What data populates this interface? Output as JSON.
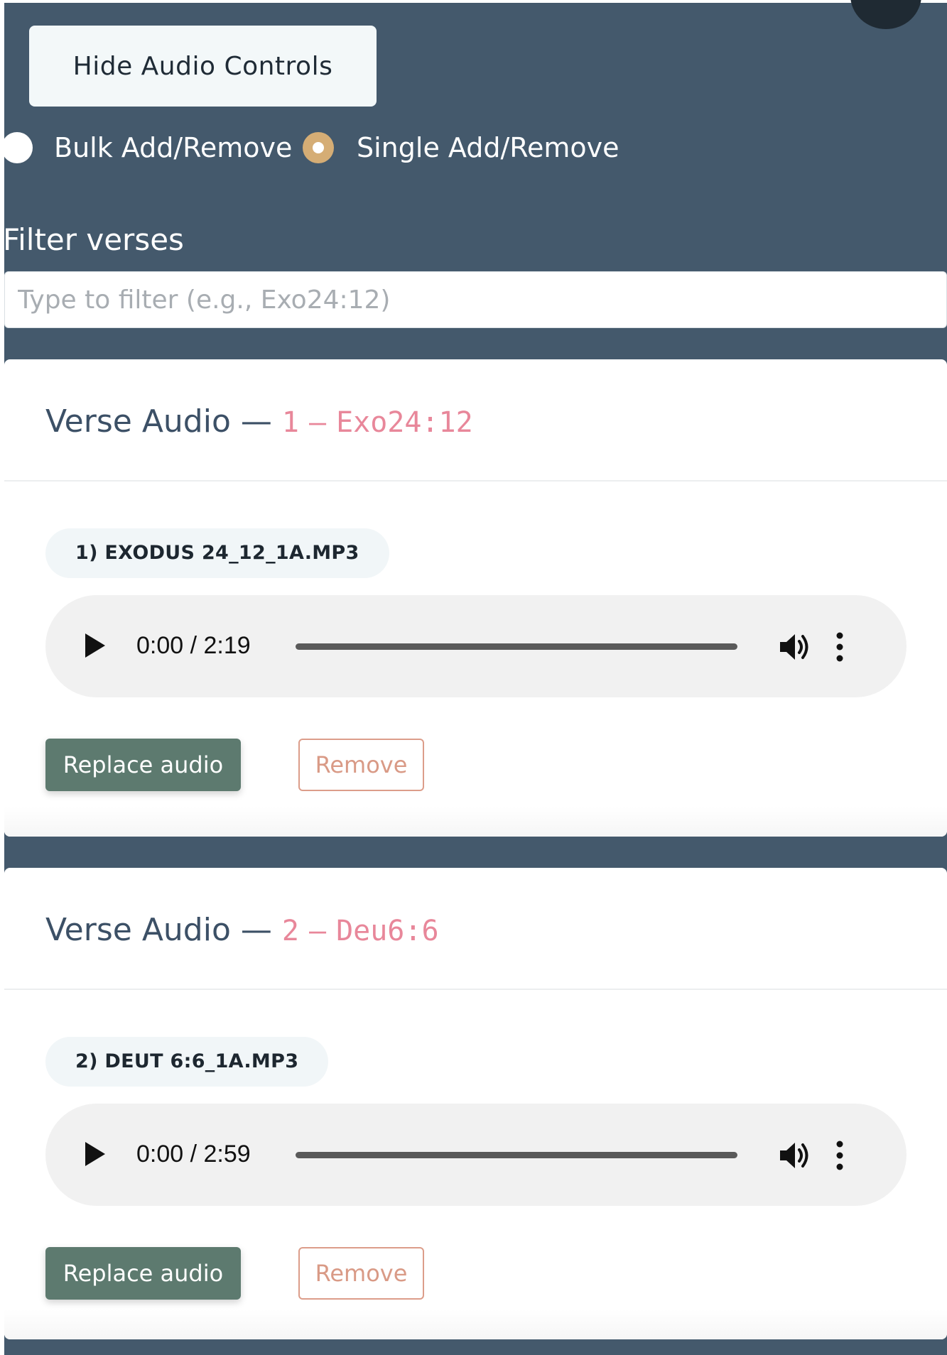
{
  "controls": {
    "toggle_label": "Hide Audio Controls",
    "mode": {
      "options": [
        "Bulk Add/Remove",
        "Single Add/Remove"
      ],
      "selected": "Single Add/Remove"
    }
  },
  "filter": {
    "label": "Filter verses",
    "placeholder": "Type to filter (e.g., Exo24:12)",
    "value": ""
  },
  "cards": [
    {
      "title_prefix": "Verse Audio —",
      "index": "1",
      "separator": "–",
      "verse": "Exo24:12",
      "file_name": "1) EXODUS 24_12_1A.MP3",
      "player": {
        "time": "0:00 / 2:19",
        "progress": 0
      },
      "replace_label": "Replace audio",
      "remove_label": "Remove"
    },
    {
      "title_prefix": "Verse Audio —",
      "index": "2",
      "separator": "–",
      "verse": "Deu6:6",
      "file_name": "2) DEUT 6:6_1A.MP3",
      "player": {
        "time": "0:00 / 2:59",
        "progress": 0
      },
      "replace_label": "Replace audio",
      "remove_label": "Remove"
    }
  ],
  "icons": {
    "play": "play-icon",
    "volume": "volume-icon",
    "more": "more-vertical-icon"
  },
  "colors": {
    "panel_bg": "#44596c",
    "accent_radio": "#d5ad75",
    "verse_ref": "#e8879a",
    "replace_button": "#5d7a6f",
    "remove_button": "#dc9d8a"
  }
}
